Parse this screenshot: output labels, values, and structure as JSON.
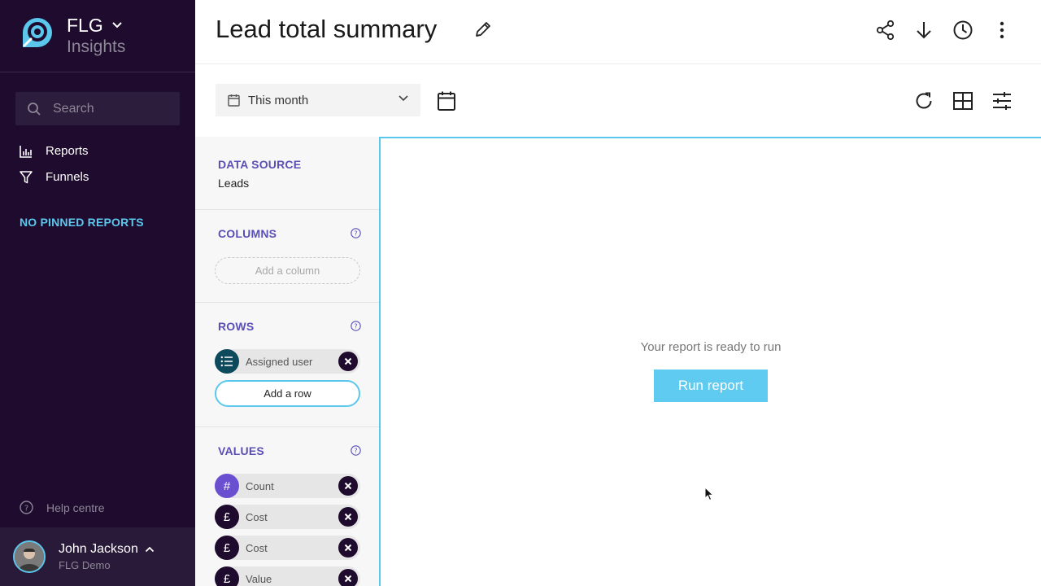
{
  "brand": {
    "name": "FLG",
    "subtitle": "Insights"
  },
  "sidebar": {
    "search_placeholder": "Search",
    "nav": [
      {
        "label": "Reports",
        "icon": "bar-chart-icon"
      },
      {
        "label": "Funnels",
        "icon": "funnel-icon"
      }
    ],
    "pinned_label": "NO PINNED REPORTS",
    "help_label": "Help centre",
    "user": {
      "name": "John Jackson",
      "org": "FLG Demo"
    }
  },
  "header": {
    "title": "Lead total summary",
    "icons": [
      "share-icon",
      "download-icon",
      "history-icon",
      "more-vertical-icon"
    ]
  },
  "toolbar": {
    "date_range": "This month",
    "icons": [
      "refresh-icon",
      "table-view-icon",
      "settings-sliders-icon"
    ]
  },
  "config": {
    "data_source": {
      "title": "DATA SOURCE",
      "value": "Leads"
    },
    "columns": {
      "title": "COLUMNS",
      "add_label": "Add a column"
    },
    "rows": {
      "title": "ROWS",
      "items": [
        {
          "label": "Assigned user",
          "icon": "list-icon",
          "color": "#0d4a5c"
        }
      ],
      "add_label": "Add a row"
    },
    "values": {
      "title": "VALUES",
      "items": [
        {
          "label": "Count",
          "glyph": "#",
          "color": "#6a4fd1"
        },
        {
          "label": "Cost",
          "glyph": "£",
          "color": "#1e0b2e"
        },
        {
          "label": "Cost",
          "glyph": "£",
          "color": "#1e0b2e"
        },
        {
          "label": "Value",
          "glyph": "£",
          "color": "#1e0b2e"
        }
      ]
    }
  },
  "canvas": {
    "message": "Your report is ready to run",
    "run_label": "Run report"
  },
  "colors": {
    "sidebar_bg": "#1e0b2e",
    "accent": "#5bc7ec",
    "section_title": "#5a4fb5",
    "run_button": "#60cbf0"
  }
}
